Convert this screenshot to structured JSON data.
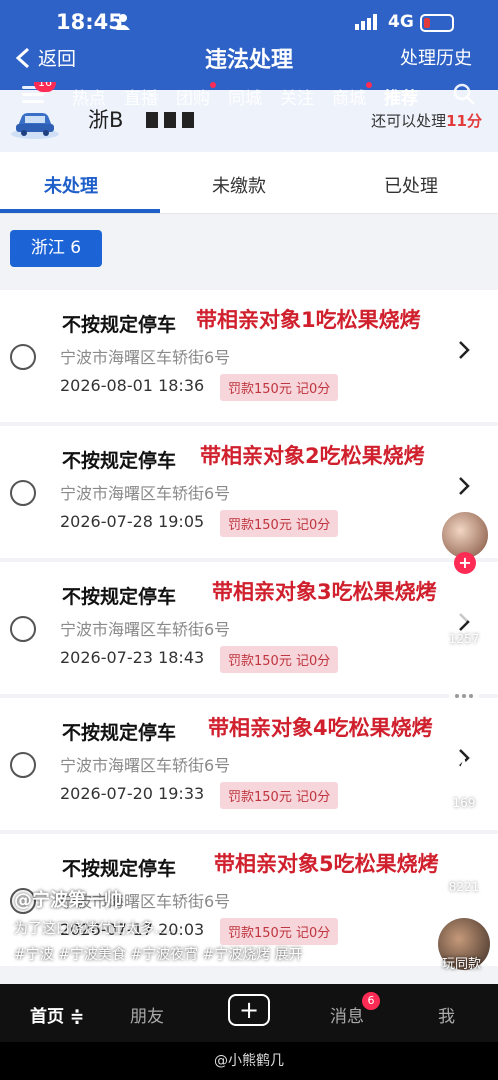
{
  "status_bar": {
    "time": "18:45",
    "network": "4G"
  },
  "app_bar": {
    "back_label": "返回",
    "title": "违法处理",
    "history_label": "处理历史"
  },
  "douyin_nav": {
    "badge": "16",
    "items": [
      "热点",
      "直播",
      "团购",
      "同城",
      "关注",
      "商城",
      "推荐"
    ]
  },
  "plate": {
    "prefix": "浙B",
    "remaining_prefix": "还可以处理",
    "remaining_count": "11分"
  },
  "tabs": [
    "未处理",
    "未缴款",
    "已处理"
  ],
  "region_chip": "浙江 6",
  "violations": [
    {
      "name": "不按规定停车",
      "address": "宁波市海曙区车轿街6号",
      "date": "2026-08-01 18:36",
      "fine": "罚款150元 记0分",
      "overlay": "带相亲对象1吃松果烧烤"
    },
    {
      "name": "不按规定停车",
      "address": "宁波市海曙区车轿街6号",
      "date": "2026-07-28 19:05",
      "fine": "罚款150元 记0分",
      "overlay": "带相亲对象2吃松果烧烤"
    },
    {
      "name": "不按规定停车",
      "address": "宁波市海曙区车轿街6号",
      "date": "2026-07-23 18:43",
      "fine": "罚款150元 记0分",
      "overlay": "带相亲对象3吃松果烧烤"
    },
    {
      "name": "不按规定停车",
      "address": "宁波市海曙区车轿街6号",
      "date": "2026-07-20 19:33",
      "fine": "罚款150元 记0分",
      "overlay": "带相亲对象4吃松果烧烤"
    },
    {
      "name": "不按规定停车",
      "address": "宁波市海曙区车轿街6号",
      "date": "2026-07-17 20:03",
      "fine": "罚款150元 记0分",
      "overlay": "带相亲对象5吃松果烧烤"
    }
  ],
  "side_actions": {
    "likes": "1257",
    "stars": "169",
    "shares": "8221",
    "music_label": "玩同款"
  },
  "caption": {
    "author": "@宁波第一帅",
    "description": "为了这口烧烤付出太多......",
    "tags": "#宁波 #宁波美食 #宁波夜宵 #宁波烧烤 展开"
  },
  "bottom_nav": {
    "home": "首页",
    "friends": "朋友",
    "messages": "消息",
    "messages_badge": "6",
    "me": "我"
  },
  "watermark": "@小熊鹤几",
  "colors": {
    "app_blue": "#2f62c6",
    "tab_active": "#1f5fc9",
    "overlay_red": "#d0202d",
    "fine_bg": "#f6d6da",
    "douyin_red": "#fe2c55"
  }
}
